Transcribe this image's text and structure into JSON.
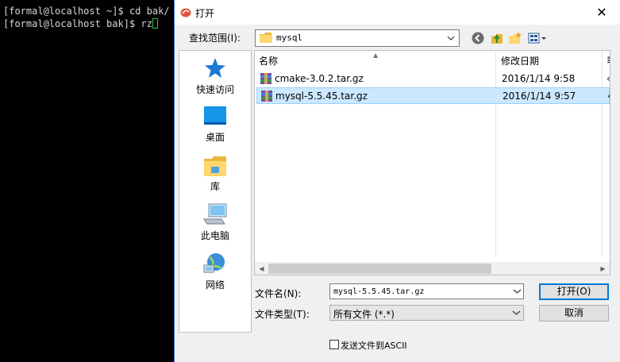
{
  "terminal": {
    "line1": "[formal@localhost ~]$ cd bak/",
    "line2": "[formal@localhost bak]$ rz"
  },
  "dialog": {
    "title": "打开",
    "close_glyph": "✕",
    "lookin_label": "查找范围(I):",
    "lookin_value": "mysql",
    "places": [
      {
        "label": "快速访问",
        "icon": "star-icon"
      },
      {
        "label": "桌面",
        "icon": "desktop-icon"
      },
      {
        "label": "库",
        "icon": "library-icon"
      },
      {
        "label": "此电脑",
        "icon": "computer-icon"
      },
      {
        "label": "网络",
        "icon": "network-icon"
      }
    ],
    "columns": {
      "name": "名称",
      "date": "修改日期",
      "truncated": "≣"
    },
    "files": [
      {
        "name": "cmake-3.0.2.tar.gz",
        "date": "2016/1/14 9:58",
        "truncated": "‹"
      },
      {
        "name": "mysql-5.5.45.tar.gz",
        "date": "2016/1/14 9:57",
        "truncated": "‹"
      }
    ],
    "filename_label": "文件名(N):",
    "filename_value": "mysql-5.5.45.tar.gz",
    "filetype_label": "文件类型(T):",
    "filetype_value": "所有文件 (*.*)",
    "open_label": "打开(O)",
    "cancel_label": "取消",
    "ascii_label": "发送文件到ASCII"
  },
  "colors": {
    "accent": "#0078d7",
    "selection": "#cce8ff"
  }
}
